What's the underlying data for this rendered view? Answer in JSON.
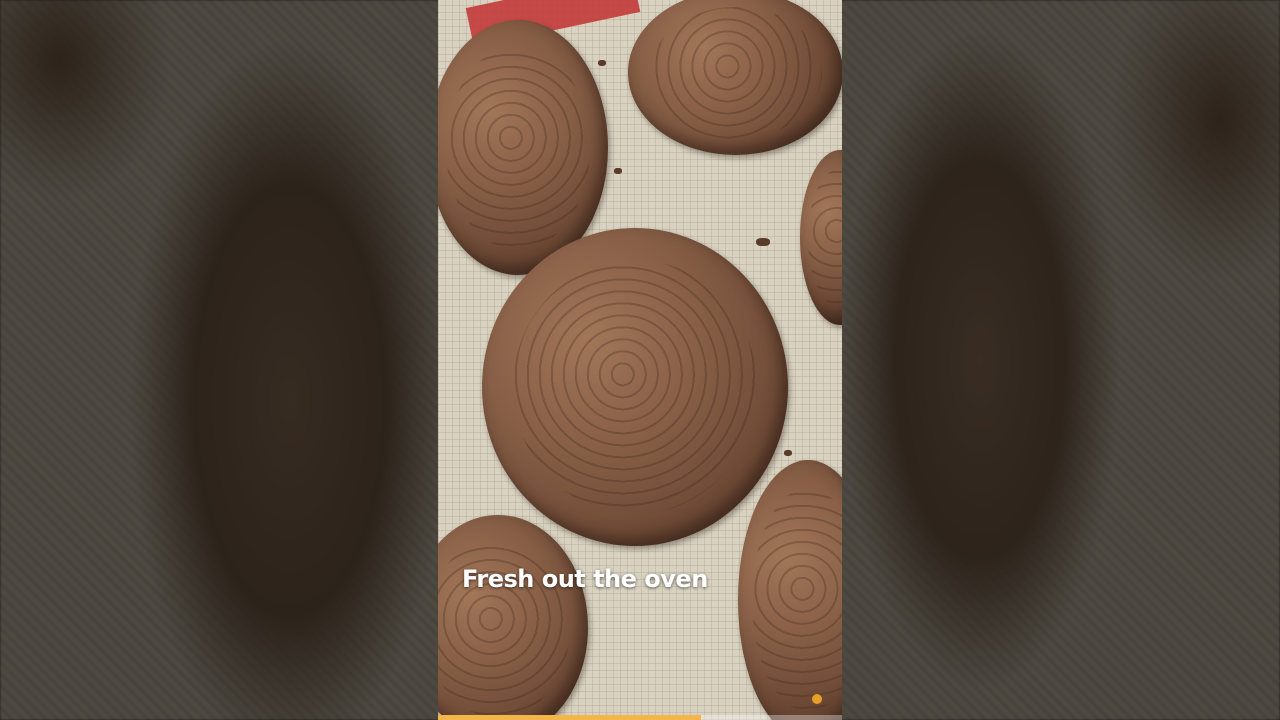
{
  "caption": {
    "text": "Fresh out the oven"
  },
  "playback": {
    "progress": 0.65
  },
  "colors": {
    "progress_fill": "#f2b64a",
    "caption_text": "#ffffff",
    "mat": "#d9d2c1",
    "cookie": "#8a6148"
  }
}
